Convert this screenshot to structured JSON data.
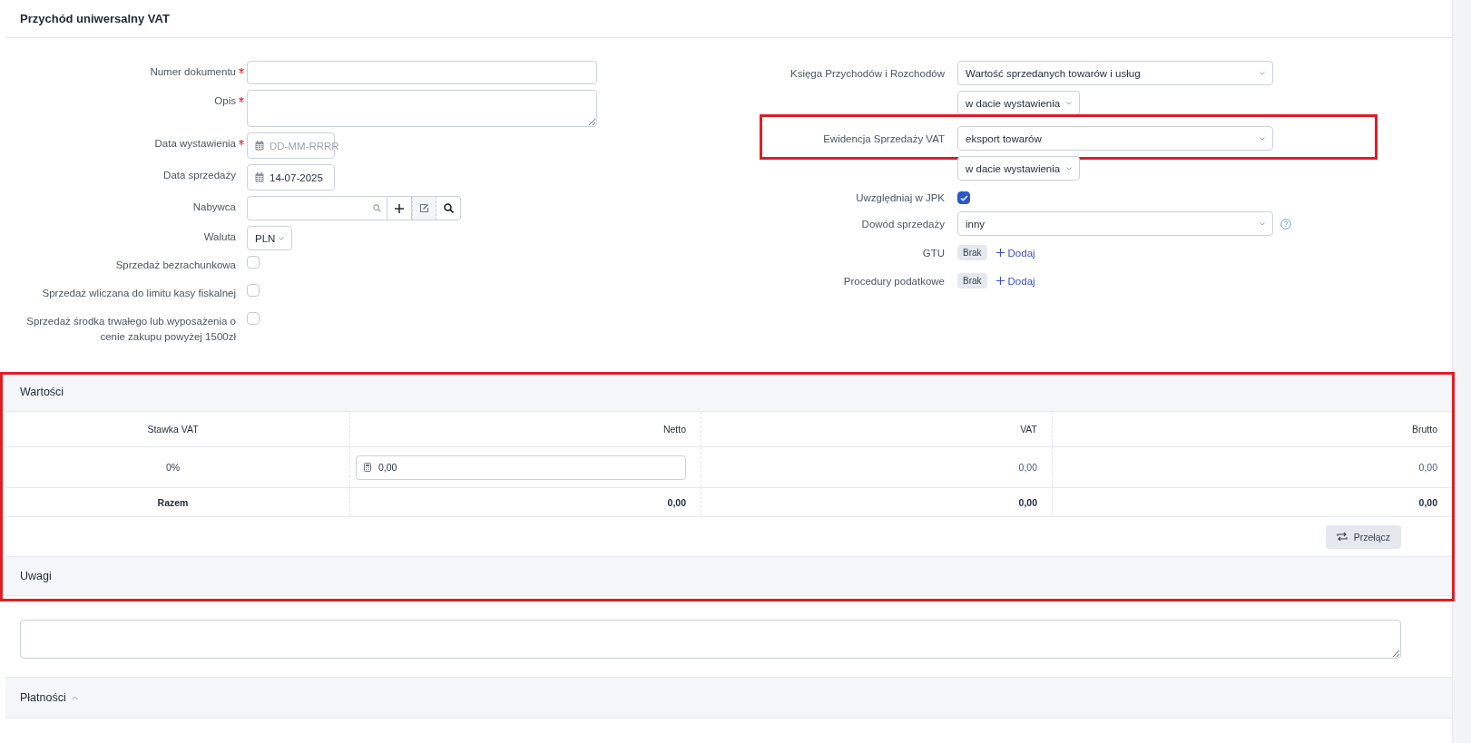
{
  "title": "Przychód uniwersalny VAT",
  "left_fields": [
    {
      "kind": "text",
      "label": "Numer dokumentu",
      "required": true
    },
    {
      "kind": "textarea",
      "label": "Opis",
      "required": true
    },
    {
      "kind": "date",
      "label": "Data wystawienia",
      "required": true,
      "placeholder": "DD-MM-RRRR"
    },
    {
      "kind": "date",
      "label": "Data sprzedaży",
      "required": false,
      "value": "14-07-2025"
    },
    {
      "kind": "lookup",
      "label": "Nabywca",
      "required": false
    },
    {
      "kind": "select",
      "label": "Waluta",
      "required": false,
      "value": "PLN"
    },
    {
      "kind": "checkbox",
      "label": "Sprzedaż bezrachunkowa",
      "checked": false
    },
    {
      "kind": "checkbox",
      "label": "Sprzedaż wliczana do limitu kasy fiskalnej",
      "checked": false
    },
    {
      "kind": "checkbox",
      "label": "Sprzedaż środka trwałego lub wyposażenia o cenie zakupu powyżej 1500zł",
      "checked": false
    }
  ],
  "right_fields": [
    {
      "kind": "select2",
      "label": "Księga Przychodów i Rozchodów",
      "value": "Wartość sprzedanych towarów i usług",
      "sub_value": "w dacie wystawienia",
      "highlighted": false
    },
    {
      "kind": "select2",
      "label": "Ewidencja Sprzedaży VAT",
      "value": "eksport towarów",
      "sub_value": "w dacie wystawienia",
      "highlighted": true
    },
    {
      "kind": "checkbox",
      "label": "Uwzględniaj w JPK",
      "checked": true
    },
    {
      "kind": "select",
      "label": "Dowód sprzedaży",
      "value": "inny",
      "help": true
    },
    {
      "kind": "tags",
      "label": "GTU",
      "tag": "Brak",
      "add": "Dodaj"
    },
    {
      "kind": "tags",
      "label": "Procedury podatkowe",
      "tag": "Brak",
      "add": "Dodaj"
    }
  ],
  "values": {
    "title": "Wartości",
    "highlighted": true,
    "columns": [
      "Stawka VAT",
      "Netto",
      "VAT",
      "Brutto"
    ],
    "rows": [
      {
        "rate": "0%",
        "netto": "0,00",
        "vat": "0,00",
        "brutto": "0,00"
      }
    ],
    "total": {
      "label": "Razem",
      "netto": "0,00",
      "vat": "0,00",
      "brutto": "0,00"
    },
    "button": "Przełącz"
  },
  "notes": {
    "title": "Uwagi"
  },
  "payments": {
    "title": "Płatności",
    "expanded": true
  }
}
